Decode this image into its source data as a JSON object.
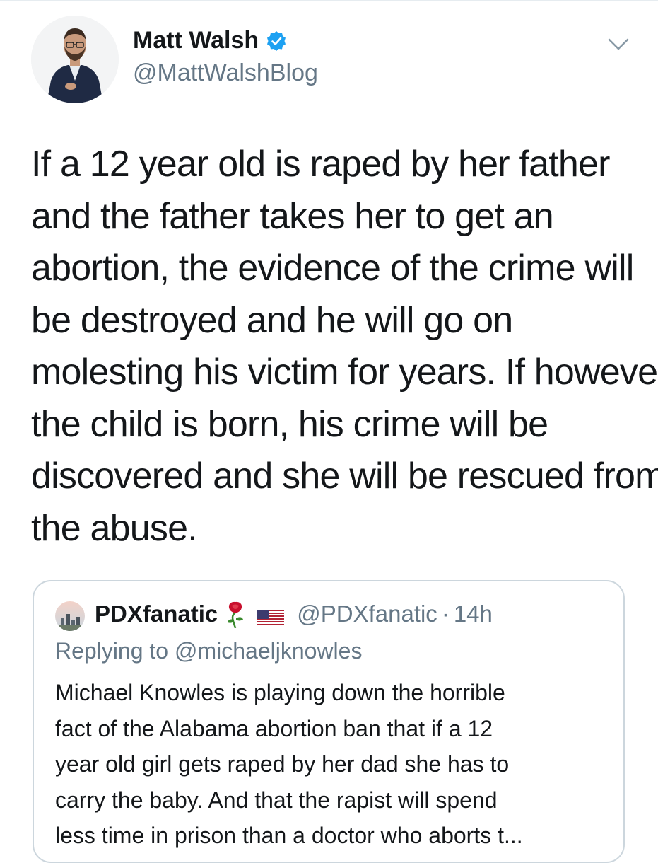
{
  "tweet": {
    "author_name": "Matt Walsh",
    "author_handle": "@MattWalshBlog",
    "verified_icon": "verified-badge-icon",
    "menu_icon": "chevron-down-icon",
    "accent_color": "#1da1f2",
    "text_lines": [
      "If a 12 year old is raped by her father",
      "and the father takes her to get an",
      "abortion, the evidence of the crime will",
      "be destroyed and he will go on",
      "molesting his victim for years. If however",
      "the child is born, his crime will be",
      "discovered and she will be rescued from",
      "the abuse."
    ]
  },
  "quoted_tweet": {
    "author_name": "PDXfanatic",
    "author_emoji_icons": [
      "rose-emoji-icon",
      "us-flag-emoji-icon"
    ],
    "author_handle": "@PDXfanatic",
    "separator": "·",
    "time": "14h",
    "replying_to": "Replying to @michaeljknowles",
    "text_lines": [
      "Michael Knowles is playing down the horrible",
      "fact of the Alabama abortion ban that if a 12",
      "year old girl gets raped by her dad she has to",
      "carry the baby. And that the rapist will spend",
      "less time in prison than a doctor who aborts t..."
    ]
  },
  "colors": {
    "primary_text": "#14171a",
    "secondary_text": "#657786",
    "border": "#ccd6dd"
  }
}
